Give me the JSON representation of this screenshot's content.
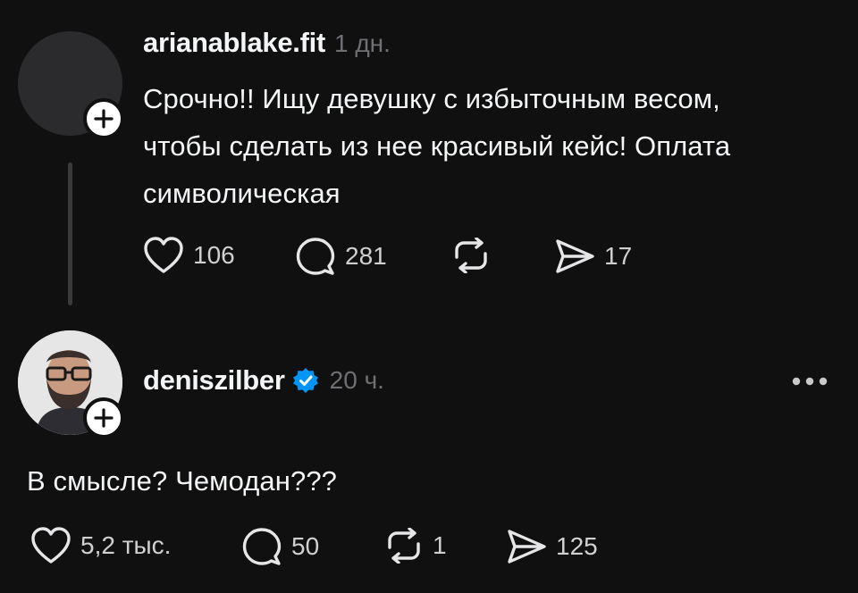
{
  "post": {
    "username": "arianablake.fit",
    "time": "1 дн.",
    "text_lines": [
      "Срочно!! Ищу девушку с избыточным весом,",
      "чтобы сделать из нее красивый кейс! Оплата",
      "символическая"
    ],
    "likes": "106",
    "comments": "281",
    "shares": "17"
  },
  "reply": {
    "username": "deniszilber",
    "time": "20 ч.",
    "text": "В смысле? Чемодан???",
    "likes": "5,2 тыс.",
    "comments": "50",
    "reposts": "1",
    "shares": "125"
  },
  "colors": {
    "background": "#101010",
    "text": "#f3f5f7",
    "muted": "#6f6f74",
    "verified": "#0095f6"
  },
  "icons": [
    "plus-icon",
    "heart-icon",
    "comment-icon",
    "repost-icon",
    "share-icon",
    "verified-icon",
    "more-icon"
  ]
}
